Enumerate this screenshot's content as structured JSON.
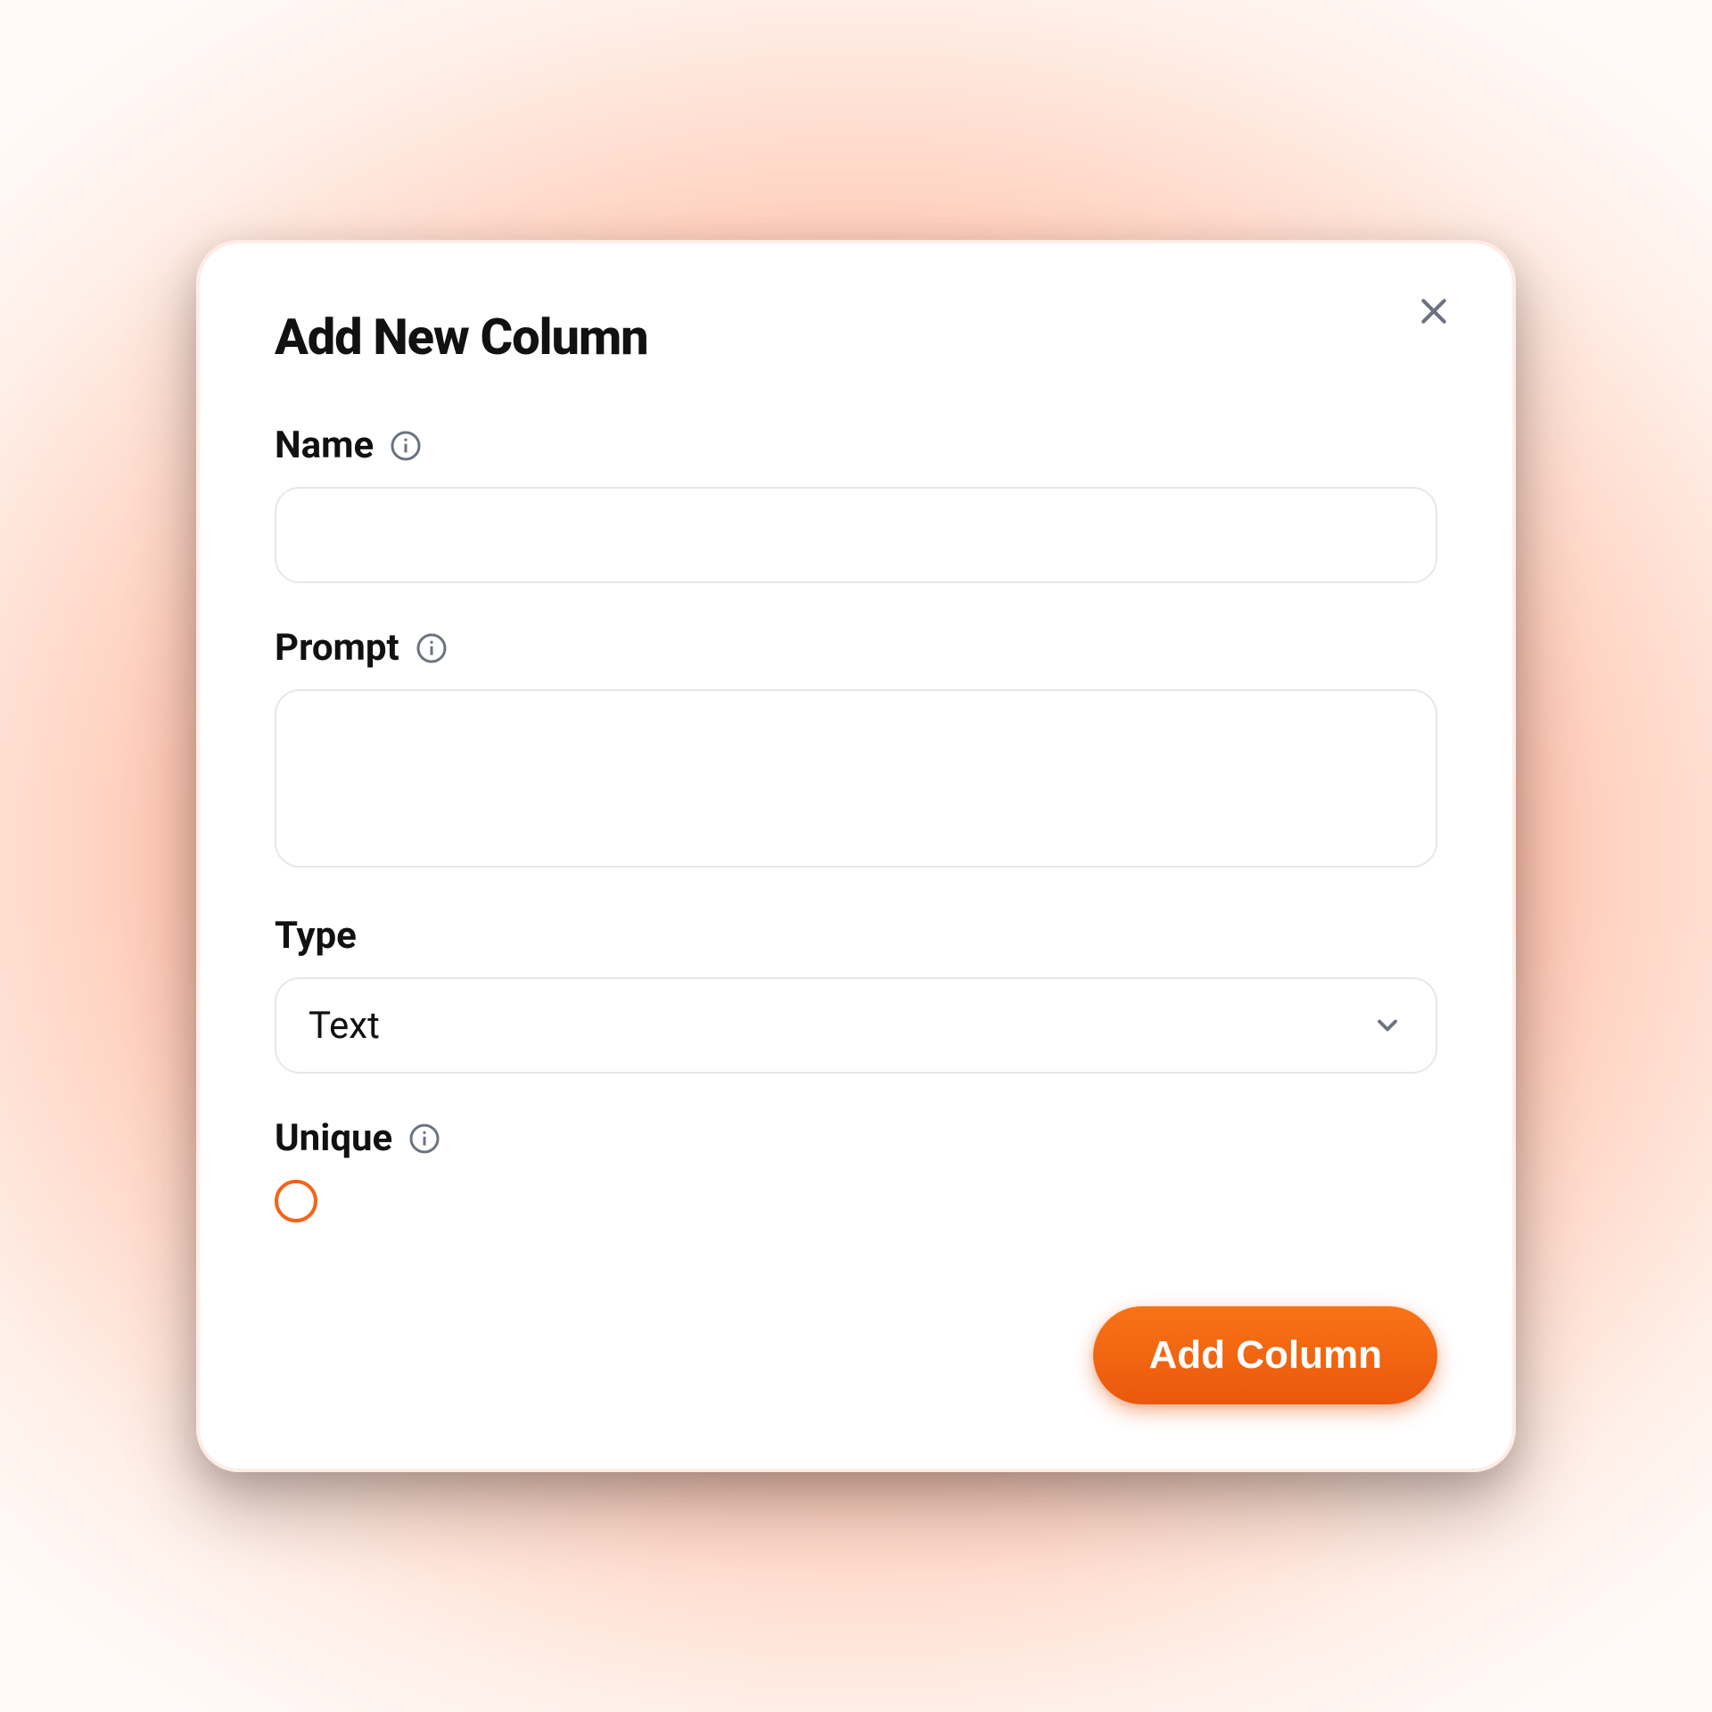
{
  "modal": {
    "title": "Add New Column",
    "close_label": "Close"
  },
  "fields": {
    "name": {
      "label": "Name",
      "value": "",
      "placeholder": ""
    },
    "prompt": {
      "label": "Prompt",
      "value": "",
      "placeholder": ""
    },
    "type": {
      "label": "Type",
      "selected": "Text"
    },
    "unique": {
      "label": "Unique",
      "checked": false
    }
  },
  "actions": {
    "submit_label": "Add Column"
  },
  "icons": {
    "info": "info-icon",
    "close": "close-icon",
    "chevron": "chevron-down-icon"
  }
}
